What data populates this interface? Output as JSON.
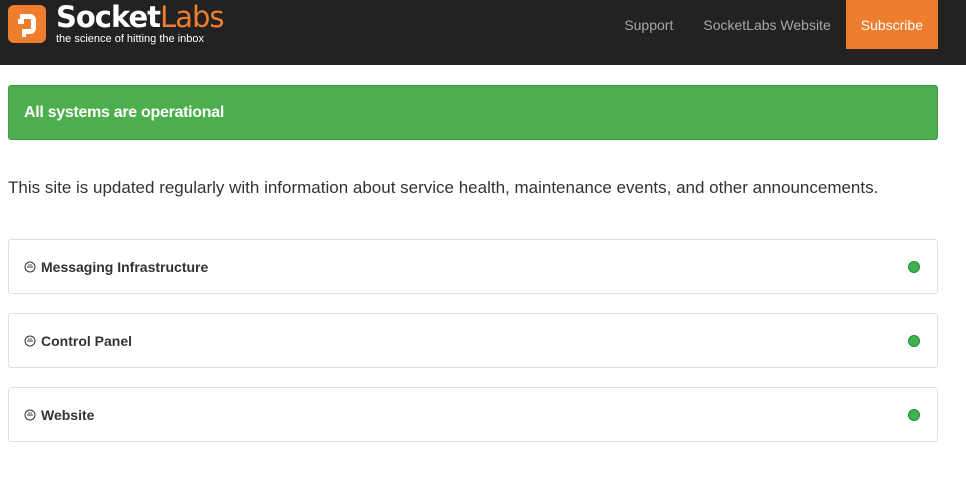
{
  "header": {
    "logo_word_1": "Socket",
    "logo_word_2": "Labs",
    "logo_tagline": "the science of hitting the inbox",
    "nav": {
      "support": "Support",
      "website": "SocketLabs Website",
      "subscribe": "Subscribe"
    }
  },
  "banner": {
    "text": "All systems are operational"
  },
  "intro": {
    "text": "This site is updated regularly with information about service health, maintenance events, and other announcements."
  },
  "components": [
    {
      "name": "Messaging Infrastructure"
    },
    {
      "name": "Control Panel"
    },
    {
      "name": "Website"
    }
  ],
  "colors": {
    "brand_orange": "#ee7d2e",
    "operational_green": "#4cae4c",
    "status_dot_green": "#3fb34f",
    "header_bg": "#222222"
  }
}
